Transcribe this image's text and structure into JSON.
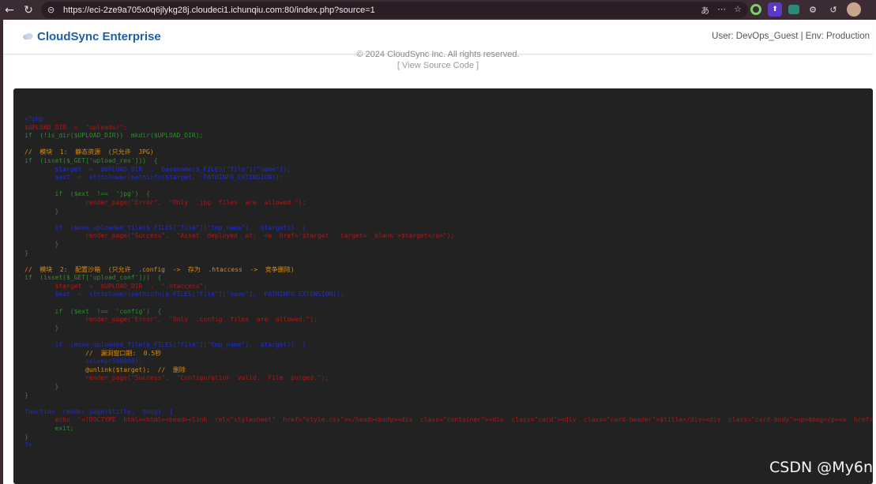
{
  "browser": {
    "url": "https://eci-2ze9a705x0q6jlykg28j.cloudeci1.ichunqiu.com:80/index.php?source=1",
    "back_icon": "←",
    "reload_icon": "↻",
    "lock_icon": "⊝"
  },
  "header": {
    "brand": "CloudSync Enterprise",
    "user_info": "User: DevOps_Guest | Env: Production"
  },
  "footer": {
    "copyright": "© 2024 CloudSync Inc. All rights reserved.",
    "view_source": "[ View Source Code ]"
  },
  "code": {
    "lines": [
      {
        "t": "<?php",
        "c": "b"
      },
      {
        "t": "$UPLOAD_DIR  =  \"uploads/\";",
        "c": "r"
      },
      {
        "t": "if  (!is_dir($UPLOAD_DIR))  mkdir($UPLOAD_DIR);",
        "c": "g"
      },
      {
        "t": "",
        "c": "g"
      },
      {
        "t": "//  模块  1:  静态资源  (只允许  JPG)",
        "c": "o"
      },
      {
        "t": "if  (isset($_GET['upload_res']))  {",
        "c": "g"
      },
      {
        "t": "        $target  =  $UPLOAD_DIR  .  basename($_FILES[\"file\"][\"name\"]);",
        "c": "b"
      },
      {
        "t": "        $ext  =  strtolower(pathinfo($target,  PATHINFO_EXTENSION));",
        "c": "b"
      },
      {
        "t": "",
        "c": "g"
      },
      {
        "t": "        if  ($ext  !==  'jpg')  {",
        "c": "g"
      },
      {
        "t": "                render_page(\"Error\",  \"Only  .jpg  files  are  allowed.\");",
        "c": "r"
      },
      {
        "t": "        }",
        "c": "g"
      },
      {
        "t": "",
        "c": "g"
      },
      {
        "t": "        if  (move_uploaded_file($_FILES[\"file\"][\"tmp_name\"],  $target))  {",
        "c": "b"
      },
      {
        "t": "                render_page(\"Success\",  \"Asset  deployed  at:  <a  href='$target'  target='_blank'>$target</a>\");",
        "c": "r"
      },
      {
        "t": "        }",
        "c": "g"
      },
      {
        "t": "}",
        "c": "g"
      },
      {
        "t": "",
        "c": "g"
      },
      {
        "t": "//  模块  2:  配置沙箱  (只允许  .config  ->  存为  .htaccess  ->  竞争删除)",
        "c": "o"
      },
      {
        "t": "if  (isset($_GET['upload_conf']))  {",
        "c": "g"
      },
      {
        "t": "        $target  =  $UPLOAD_DIR  .  \".htaccess\";",
        "c": "r"
      },
      {
        "t": "        $ext  =  strtolower(pathinfo($_FILES[\"file\"][\"name\"],  PATHINFO_EXTENSION));",
        "c": "b"
      },
      {
        "t": "",
        "c": "g"
      },
      {
        "t": "        if  ($ext  !==  'config')  {",
        "c": "g"
      },
      {
        "t": "                render_page(\"Error\",  \"Only  .config  files  are  allowed.\");",
        "c": "r"
      },
      {
        "t": "        }",
        "c": "g"
      },
      {
        "t": "",
        "c": "g"
      },
      {
        "t": "        if  (move_uploaded_file($_FILES[\"file\"][\"tmp_name\"],  $target))  {",
        "c": "b"
      },
      {
        "t": "                //  漏洞窗口期:  0.5秒",
        "c": "o"
      },
      {
        "t": "                usleep(500000);",
        "c": "b"
      },
      {
        "t": "                @unlink($target);  //  删除",
        "c": "o"
      },
      {
        "t": "                render_page(\"Success\",  \"Configuration  valid.  File  purged.\");",
        "c": "r"
      },
      {
        "t": "        }",
        "c": "g"
      },
      {
        "t": "}",
        "c": "g"
      },
      {
        "t": "",
        "c": "g"
      },
      {
        "t": "function  render_page($title,  $msg)  {",
        "c": "b"
      },
      {
        "t": "        echo  '<!DOCTYPE  html><html><head><link  rel=\"stylesheet\"  href=\"style.css\"></head><body><div  class=\"container\"><div  class=\"card\"><div  class=\"card-header\">$title</div><div  class=\"card-body\"><p>$msg</p><a  href=\"index.php\">",
        "c": "r"
      },
      {
        "t": "        exit;",
        "c": "g"
      },
      {
        "t": "}",
        "c": "g"
      },
      {
        "t": "?>",
        "c": "b"
      }
    ]
  },
  "watermark": "CSDN @My6n"
}
